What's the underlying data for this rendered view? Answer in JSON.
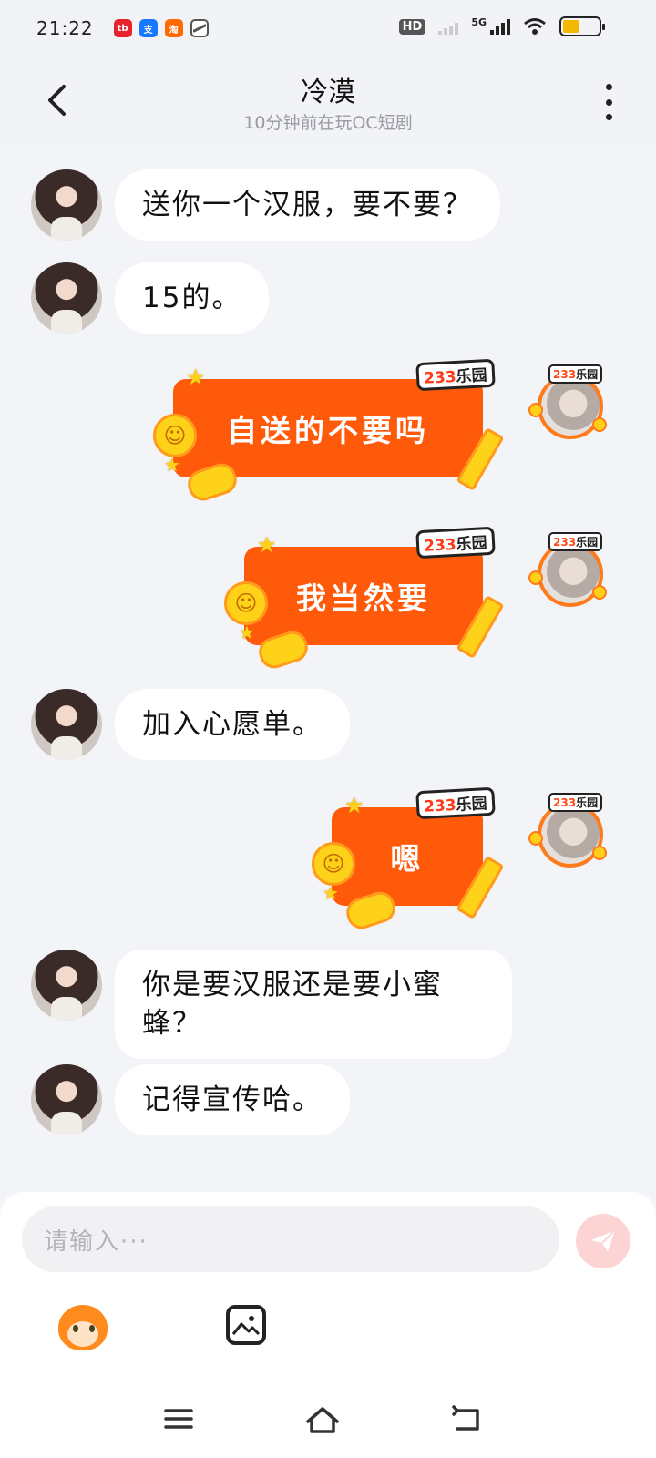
{
  "status_bar": {
    "time": "21:22",
    "apps": [
      {
        "icon": "weibo-app-icon",
        "label": "tb",
        "color": "#e8232b"
      },
      {
        "icon": "alipay-app-icon",
        "label": "支",
        "color": "#1677ff"
      },
      {
        "icon": "taobao-app-icon",
        "label": "淘",
        "color": "#ff6a00"
      },
      {
        "icon": "link-app-icon",
        "label": "",
        "color": "#555555"
      }
    ],
    "hd_label": "HD",
    "network_label": "5G",
    "battery_percent": 45
  },
  "header": {
    "title": "冷漠",
    "subtitle": "10分钟前在玩OC短剧",
    "back_icon": "chevron-left-icon",
    "more_icon": "more-vertical-icon"
  },
  "badge": {
    "num": "233",
    "text": "乐园"
  },
  "messages": [
    {
      "side": "left",
      "text": "送你一个汉服，要不要？"
    },
    {
      "side": "left",
      "text": "15的。"
    },
    {
      "side": "right",
      "text": "自送的不要吗"
    },
    {
      "side": "right",
      "text": "我当然要"
    },
    {
      "side": "left",
      "text": "加入心愿单。"
    },
    {
      "side": "right",
      "text": "嗯"
    },
    {
      "side": "left",
      "text": "你是要汉服还是要小蜜蜂？"
    },
    {
      "side": "left",
      "text": "记得宣传哈。"
    }
  ],
  "input": {
    "placeholder": "请输入···",
    "send_icon": "send-icon"
  },
  "toolbar": {
    "emoji_icon": "emoji-mascot-icon",
    "image_icon": "image-icon"
  },
  "nav": {
    "menu_icon": "menu-icon",
    "home_icon": "home-icon",
    "back_icon": "back-icon"
  },
  "colors": {
    "orange_bubble": "#ff5a0a",
    "background": "#f3f4f8",
    "send_button": "#fdd4d4"
  }
}
